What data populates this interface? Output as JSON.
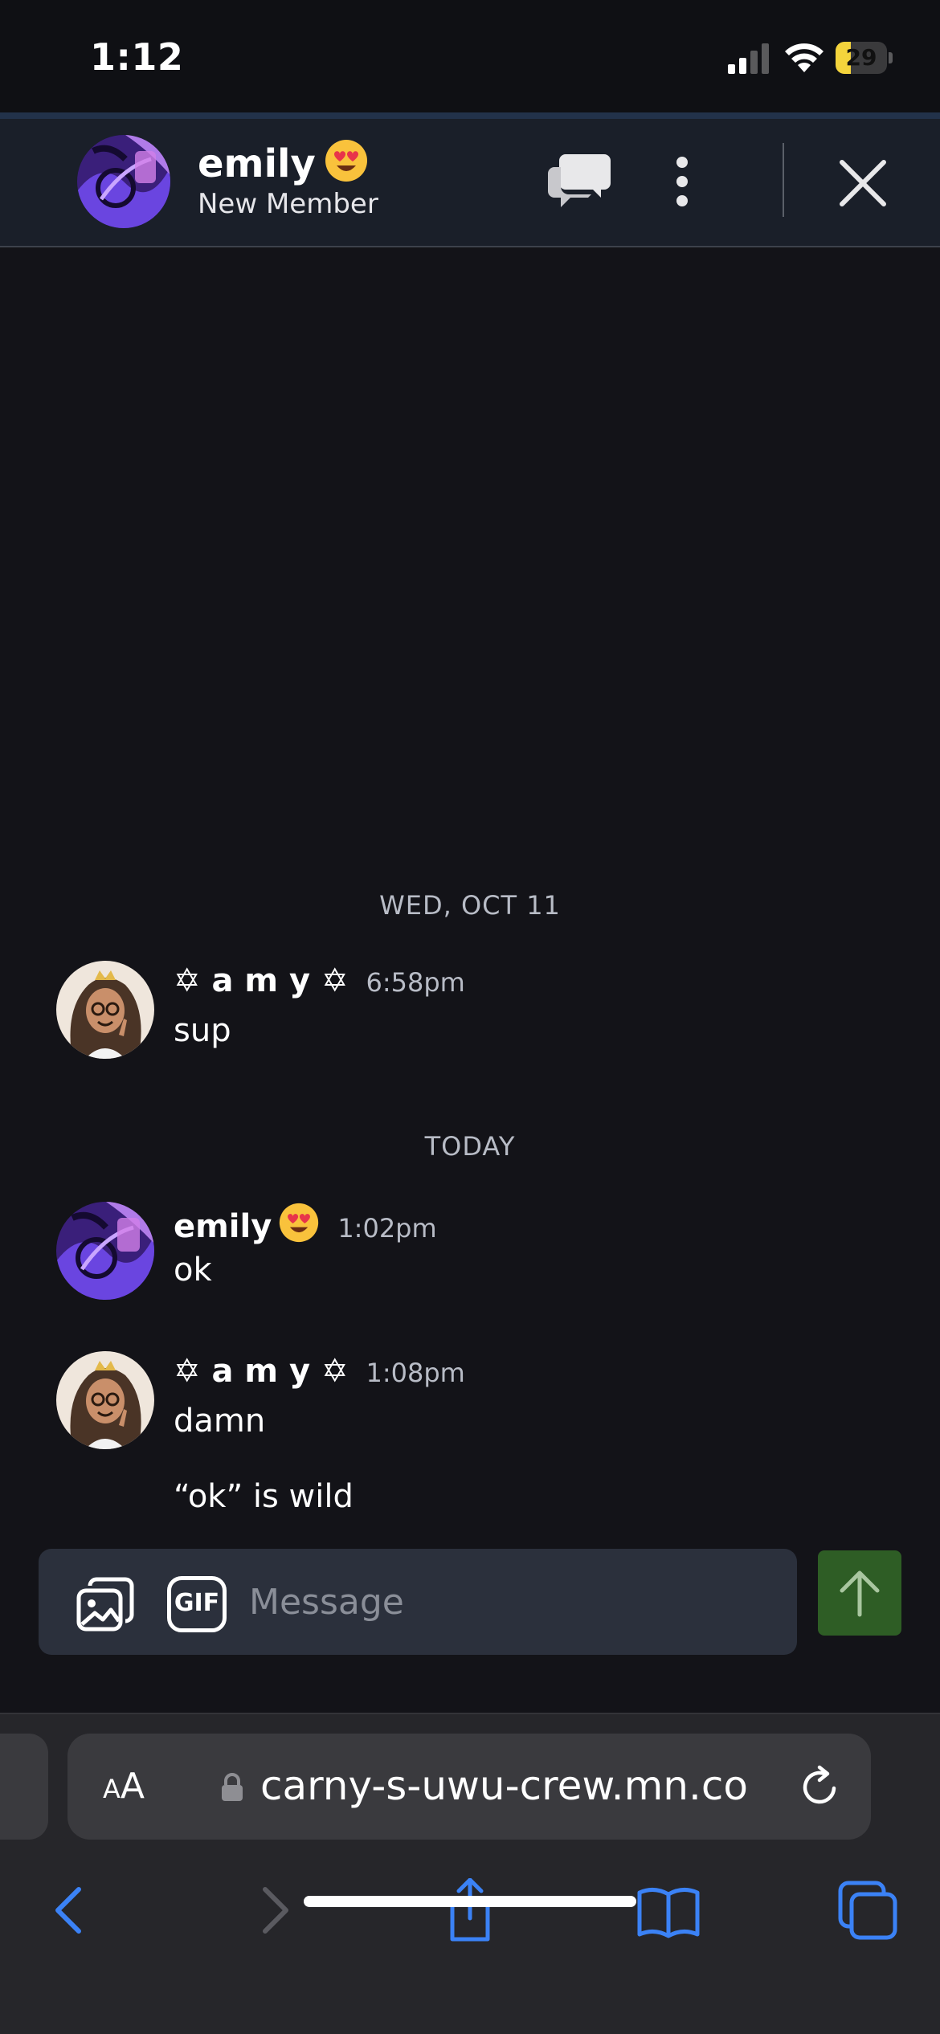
{
  "status_bar": {
    "time": "1:12",
    "battery": "29",
    "battery_level": 0.29
  },
  "header": {
    "name": "emily",
    "subtitle": "New Member",
    "name_emoji": "heart-eyes-emoji"
  },
  "dates": {
    "first": "WED, OCT 11",
    "second": "TODAY"
  },
  "messages": [
    {
      "author": "✡ a m y ✡",
      "time": "6:58pm",
      "lines": [
        "sup"
      ],
      "avatar": "amy-avatar"
    },
    {
      "author": "emily",
      "time": "1:02pm",
      "lines": [
        "ok"
      ],
      "avatar": "emily-avatar",
      "emoji": "heart-eyes-emoji"
    },
    {
      "author": "✡ a m y ✡",
      "time": "1:08pm",
      "lines": [
        "damn",
        "“ok” is wild"
      ],
      "avatar": "amy-avatar"
    }
  ],
  "composer": {
    "gif_label": "GIF",
    "placeholder": "Message"
  },
  "browser": {
    "aa_small": "A",
    "aa_large": "A",
    "url": "carny-s-uwu-crew.mn.co"
  },
  "colors": {
    "background": "#131318",
    "header": "#1a1f29",
    "send_button": "#2e5d25",
    "safari_accent": "#3b82f6",
    "battery": "#f4d43c"
  }
}
